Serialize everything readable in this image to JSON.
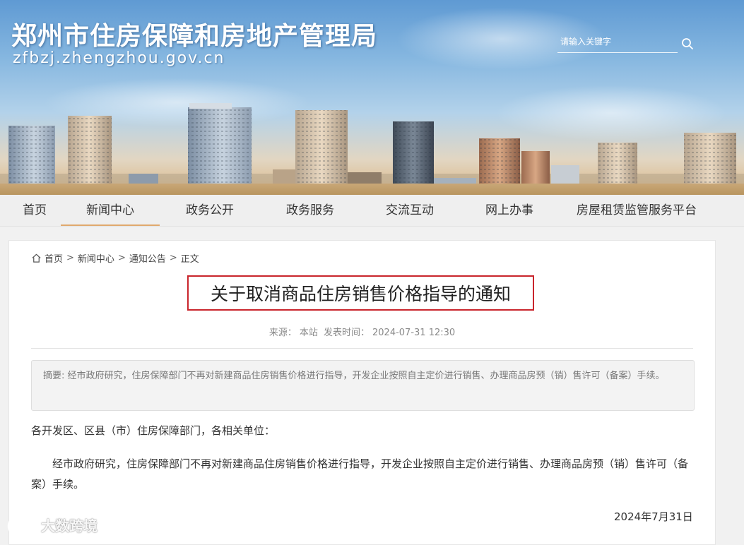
{
  "header": {
    "site_title": "郑州市住房保障和房地产管理局",
    "site_domain": "zfbzj.zhengzhou.gov.cn",
    "search_placeholder": "请输入关键字",
    "icon": "search-icon"
  },
  "nav": {
    "items": [
      {
        "label": "首页",
        "active": false
      },
      {
        "label": "新闻中心",
        "active": true
      },
      {
        "label": "政务公开",
        "active": false
      },
      {
        "label": "政务服务",
        "active": false
      },
      {
        "label": "交流互动",
        "active": false
      },
      {
        "label": "网上办事",
        "active": false
      },
      {
        "label": "房屋租赁监管服务平台",
        "active": false
      }
    ],
    "active_color": "#e0a96d"
  },
  "breadcrumb": {
    "icon": "home-icon",
    "items": [
      "首页",
      "新闻中心",
      "通知公告",
      "正文"
    ],
    "separator": ">"
  },
  "article": {
    "title": "关于取消商品住房销售价格指导的通知",
    "title_border_color": "#c9252c",
    "meta": {
      "source_label": "来源：",
      "source": "本站",
      "time_label": "发表时间：",
      "time": "2024-07-31 12:30"
    },
    "summary_label": "摘要:",
    "summary": "经市政府研究，住房保障部门不再对新建商品住房销售价格进行指导，开发企业按照自主定价进行销售、办理商品房预（销）售许可（备案）手续。",
    "salutation": "各开发区、区县（市）住房保障部门，各相关单位：",
    "body": "经市政府研究，住房保障部门不再对新建商品住房销售价格进行指导，开发企业按照自主定价进行销售、办理商品房预（销）售许可（备案）手续。",
    "date": "2024年7月31日"
  },
  "watermark": {
    "text": "大数跨境"
  }
}
